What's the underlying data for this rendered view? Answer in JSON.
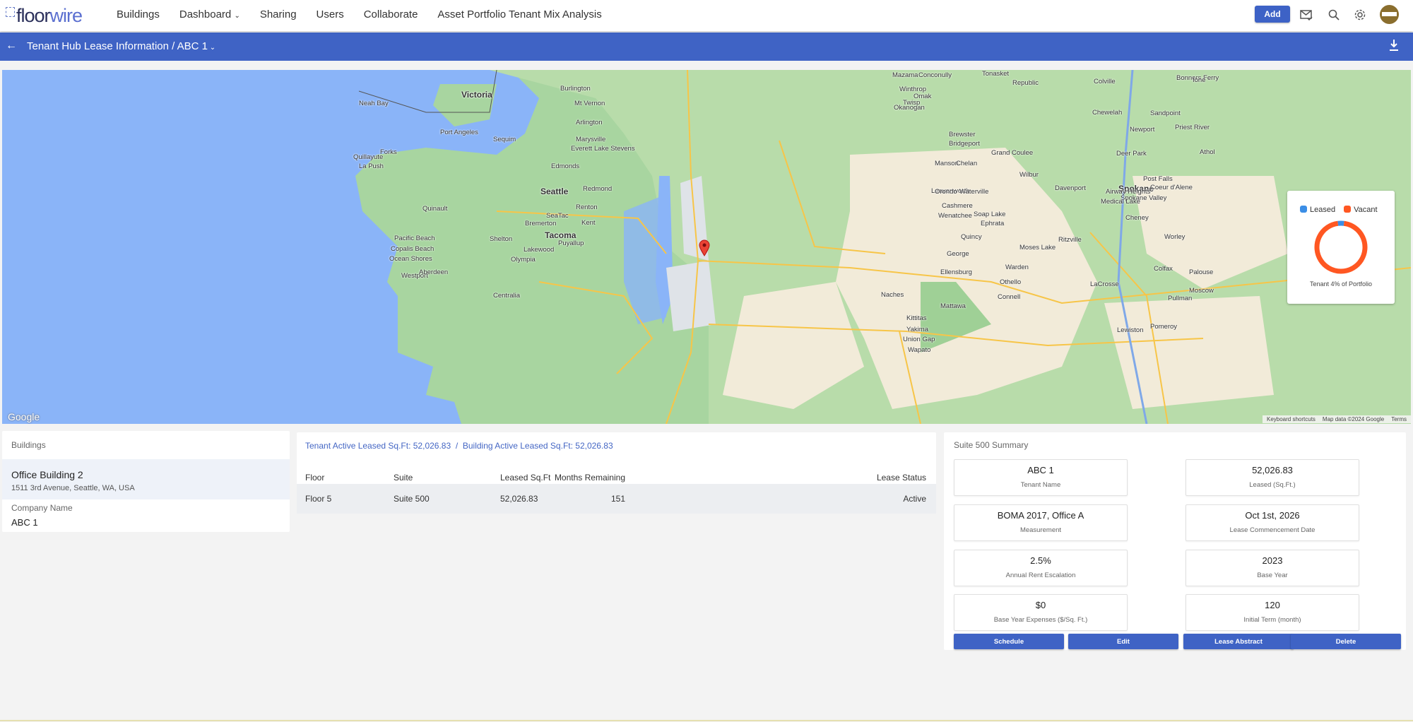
{
  "header": {
    "logo": {
      "part1": "floor",
      "part2": "wire"
    },
    "nav": [
      "Buildings",
      "Dashboard",
      "Sharing",
      "Users",
      "Collaborate",
      "Asset Portfolio Tenant Mix Analysis"
    ],
    "add_label": "Add",
    "icons": [
      "mail-check-icon",
      "search-icon",
      "gear-icon",
      "avatar"
    ]
  },
  "subbar": {
    "back_icon": "arrow-left-icon",
    "title": "Tenant Hub Lease Information",
    "separator": "/",
    "tenant": "ABC 1",
    "download_icon": "download-icon"
  },
  "map": {
    "google_label": "Google",
    "footer": [
      "Keyboard shortcuts",
      "Map data ©2024 Google",
      "Terms"
    ],
    "cities": [
      "Victoria",
      "Neah Bay",
      "Port Angeles",
      "Sequim",
      "Forks",
      "La Push",
      "Quillayute",
      "Burlington",
      "Mt Vernon",
      "Arlington",
      "Marysville",
      "Everett",
      "Lake Stevens",
      "Edmonds",
      "Seattle",
      "Redmond",
      "Bremerton",
      "Renton",
      "SeaTac",
      "Kent",
      "Tacoma",
      "Puyallup",
      "Lakewood",
      "Olympia",
      "Shelton",
      "Quinault",
      "Pacific Beach",
      "Copalis Beach",
      "Ocean Shores",
      "Westport",
      "Aberdeen",
      "Centralia",
      "Mazama",
      "Winthrop",
      "Twisp",
      "Okanogan",
      "Omak",
      "Conconully",
      "Tonasket",
      "Republic",
      "Colville",
      "Chewelah",
      "Brewster",
      "Bridgeport",
      "Grand Coulee",
      "Manson",
      "Chelan",
      "Leavenworth",
      "Cashmere",
      "Wenatchee",
      "Waterville",
      "Orondo",
      "Wilbur",
      "Davenport",
      "Spokane",
      "Spokane Valley",
      "Cheney",
      "Medical Lake",
      "Airway Heights",
      "Deer Park",
      "Newport",
      "Sandpoint",
      "Coeur d'Alene",
      "Post Falls",
      "Bonners Ferry",
      "Moses Lake",
      "Ephrata",
      "Soap Lake",
      "Quincy",
      "George",
      "Ellensburg",
      "Ritzville",
      "Othello",
      "Warden",
      "Connell",
      "Colfax",
      "Pullman",
      "Moscow",
      "Palouse",
      "LaCrosse",
      "Pomeroy",
      "Lewiston",
      "Yakima",
      "Union Gap",
      "Wapato",
      "Naches",
      "Mattawa",
      "Kittitas",
      "Worley",
      "Priest River",
      "Athol",
      "Ione"
    ],
    "marker_icon": "map-pin-icon"
  },
  "chart_data": {
    "type": "pie",
    "variant": "donut",
    "categories": [
      "Leased",
      "Vacant"
    ],
    "values": [
      4,
      96
    ],
    "colors": {
      "Leased": "#3b8ee6",
      "Vacant": "#ff5722"
    },
    "legend": "top",
    "caption": "Tenant 4% of Portfolio"
  },
  "buildings": {
    "header": "Buildings",
    "selected": {
      "name": "Office Building 2",
      "address": "1511 3rd Avenue, Seattle, WA, USA"
    },
    "company_label": "Company Name",
    "company_value": "ABC 1"
  },
  "leases": {
    "tenant_summary": "Tenant Active Leased Sq.Ft: 52,026.83",
    "separator": "/",
    "building_summary": "Building Active Leased Sq.Ft: 52,026.83",
    "columns": [
      "Floor",
      "Suite",
      "Leased Sq.Ft",
      "Months Remaining",
      "Lease Status"
    ],
    "rows": [
      [
        "Floor 5",
        "Suite 500",
        "52,026.83",
        "151",
        "Active"
      ]
    ]
  },
  "summary": {
    "title": "Suite 500 Summary",
    "items": [
      {
        "value": "ABC 1",
        "label": "Tenant Name"
      },
      {
        "value": "52,026.83",
        "label": "Leased (Sq.Ft.)"
      },
      {
        "value": "BOMA 2017, Office A",
        "label": "Measurement"
      },
      {
        "value": "Oct 1st, 2026",
        "label": "Lease Commencement Date"
      },
      {
        "value": "2.5%",
        "label": "Annual Rent Escalation"
      },
      {
        "value": "2023",
        "label": "Base Year"
      },
      {
        "value": "$0",
        "label": "Base Year Expenses ($/Sq. Ft.)"
      },
      {
        "value": "120",
        "label": "Initial Term (month)"
      }
    ],
    "buttons": [
      "Schedule",
      "Edit",
      "Lease Abstract",
      "Delete"
    ]
  },
  "colors": {
    "primary": "#3f63c5",
    "link": "#4466c4",
    "ocean": "#8ab4f8",
    "land": "#a8d5a0"
  }
}
